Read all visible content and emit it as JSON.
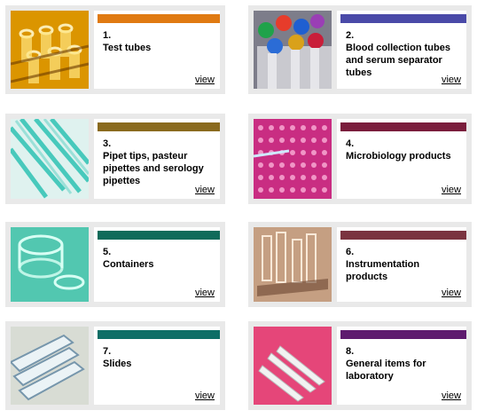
{
  "cards": [
    {
      "number": "1.",
      "title": "Test tubes",
      "link": "view",
      "bar_color": "#e07a12",
      "image": "test-tubes-photo"
    },
    {
      "number": "2.",
      "title": "Blood collection tubes and serum separator tubes",
      "link": "view",
      "bar_color": "#4a4aa8",
      "image": "blood-collection-tubes-photo"
    },
    {
      "number": "3.",
      "title": "Pipet tips, pasteur pipettes and serology pipettes",
      "link": "view",
      "bar_color": "#8a6a1e",
      "image": "pipet-tips-photo"
    },
    {
      "number": "4.",
      "title": "Microbiology products",
      "link": "view",
      "bar_color": "#7a1d3c",
      "image": "microbiology-plate-photo"
    },
    {
      "number": "5.",
      "title": "Containers",
      "link": "view",
      "bar_color": "#0f6b5a",
      "image": "containers-photo"
    },
    {
      "number": "6.",
      "title": "Instrumentation products",
      "link": "view",
      "bar_color": "#7a3440",
      "image": "instrumentation-photo"
    },
    {
      "number": "7.",
      "title": "Slides",
      "link": "view",
      "bar_color": "#0e6e66",
      "image": "slides-photo"
    },
    {
      "number": "8.",
      "title": "General items for laboratory",
      "link": "view",
      "bar_color": "#5e1a6e",
      "image": "lab-items-photo"
    }
  ]
}
